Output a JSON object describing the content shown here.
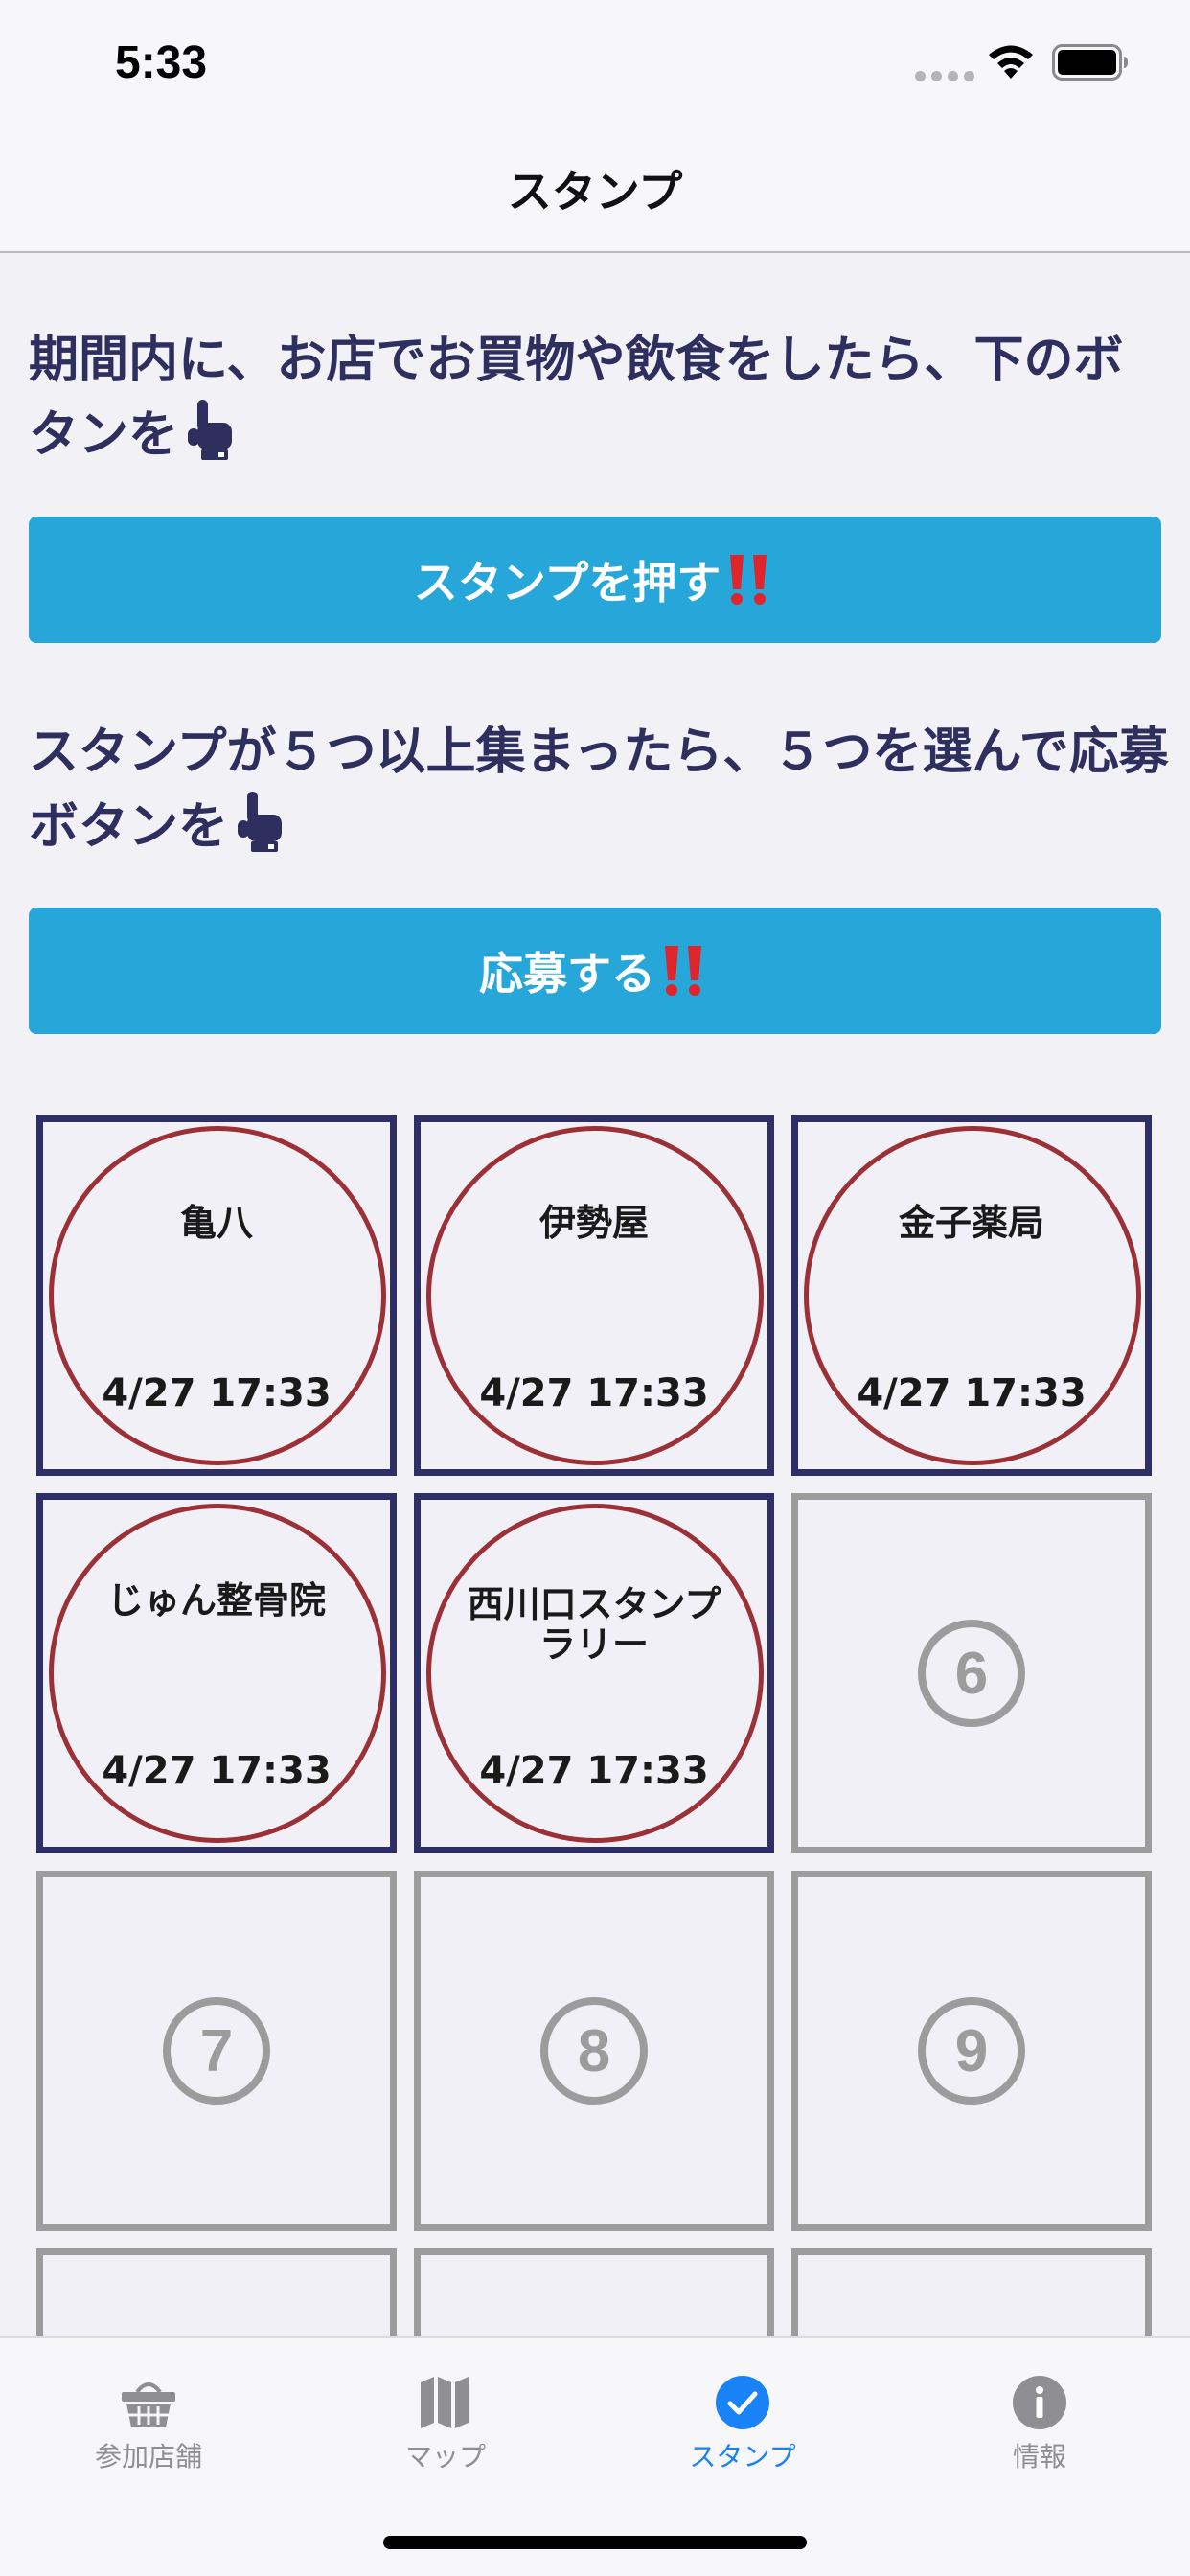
{
  "status_bar": {
    "time": "5:33"
  },
  "nav": {
    "title": "スタンプ"
  },
  "instructions": {
    "stamp_text": "期間内に、お店でお買物や飲食をしたら、下のボタンを",
    "apply_text": "スタンプが５つ以上集まったら、５つを選んで応募ボタンを"
  },
  "buttons": {
    "stamp_label": "スタンプを押す",
    "apply_label": "応募する"
  },
  "stamps": [
    {
      "name": "亀八",
      "date": "4/27 17:33"
    },
    {
      "name": "伊勢屋",
      "date": "4/27 17:33"
    },
    {
      "name": "金子薬局",
      "date": "4/27 17:33"
    },
    {
      "name": "じゅん整骨院",
      "date": "4/27 17:33"
    },
    {
      "name": "西川口スタンプラリー",
      "date": "4/27 17:33"
    }
  ],
  "empty_slots": [
    "6",
    "7",
    "8",
    "9"
  ],
  "tabs": [
    {
      "label": "参加店舗",
      "icon": "basket-icon"
    },
    {
      "label": "マップ",
      "icon": "map-icon"
    },
    {
      "label": "スタンプ",
      "icon": "checkmark-circle-icon"
    },
    {
      "label": "情報",
      "icon": "info-icon"
    }
  ],
  "colors": {
    "accent_blue": "#27a6da",
    "stamp_border": "#2d2f66",
    "stamp_circle": "#9c3037",
    "active_tab": "#1a82f7",
    "inactive": "#9c9c9c"
  }
}
